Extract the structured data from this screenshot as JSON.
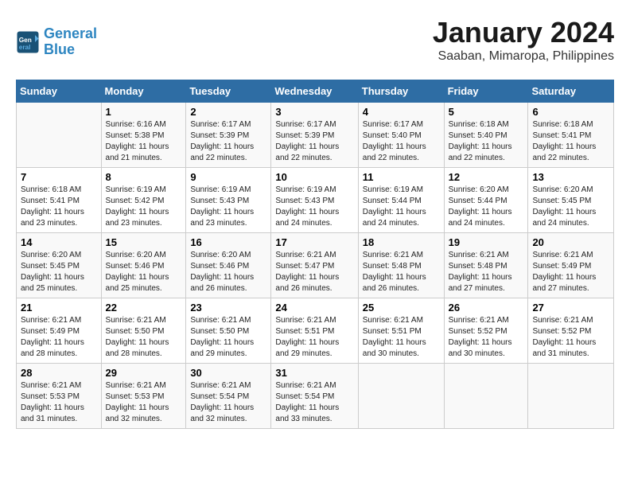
{
  "logo": {
    "line1": "General",
    "line2": "Blue"
  },
  "title": "January 2024",
  "subtitle": "Saaban, Mimaropa, Philippines",
  "weekdays": [
    "Sunday",
    "Monday",
    "Tuesday",
    "Wednesday",
    "Thursday",
    "Friday",
    "Saturday"
  ],
  "weeks": [
    [
      {
        "day": "",
        "sunrise": "",
        "sunset": "",
        "daylight": ""
      },
      {
        "day": "1",
        "sunrise": "Sunrise: 6:16 AM",
        "sunset": "Sunset: 5:38 PM",
        "daylight": "Daylight: 11 hours and 21 minutes."
      },
      {
        "day": "2",
        "sunrise": "Sunrise: 6:17 AM",
        "sunset": "Sunset: 5:39 PM",
        "daylight": "Daylight: 11 hours and 22 minutes."
      },
      {
        "day": "3",
        "sunrise": "Sunrise: 6:17 AM",
        "sunset": "Sunset: 5:39 PM",
        "daylight": "Daylight: 11 hours and 22 minutes."
      },
      {
        "day": "4",
        "sunrise": "Sunrise: 6:17 AM",
        "sunset": "Sunset: 5:40 PM",
        "daylight": "Daylight: 11 hours and 22 minutes."
      },
      {
        "day": "5",
        "sunrise": "Sunrise: 6:18 AM",
        "sunset": "Sunset: 5:40 PM",
        "daylight": "Daylight: 11 hours and 22 minutes."
      },
      {
        "day": "6",
        "sunrise": "Sunrise: 6:18 AM",
        "sunset": "Sunset: 5:41 PM",
        "daylight": "Daylight: 11 hours and 22 minutes."
      }
    ],
    [
      {
        "day": "7",
        "sunrise": "Sunrise: 6:18 AM",
        "sunset": "Sunset: 5:41 PM",
        "daylight": "Daylight: 11 hours and 23 minutes."
      },
      {
        "day": "8",
        "sunrise": "Sunrise: 6:19 AM",
        "sunset": "Sunset: 5:42 PM",
        "daylight": "Daylight: 11 hours and 23 minutes."
      },
      {
        "day": "9",
        "sunrise": "Sunrise: 6:19 AM",
        "sunset": "Sunset: 5:43 PM",
        "daylight": "Daylight: 11 hours and 23 minutes."
      },
      {
        "day": "10",
        "sunrise": "Sunrise: 6:19 AM",
        "sunset": "Sunset: 5:43 PM",
        "daylight": "Daylight: 11 hours and 24 minutes."
      },
      {
        "day": "11",
        "sunrise": "Sunrise: 6:19 AM",
        "sunset": "Sunset: 5:44 PM",
        "daylight": "Daylight: 11 hours and 24 minutes."
      },
      {
        "day": "12",
        "sunrise": "Sunrise: 6:20 AM",
        "sunset": "Sunset: 5:44 PM",
        "daylight": "Daylight: 11 hours and 24 minutes."
      },
      {
        "day": "13",
        "sunrise": "Sunrise: 6:20 AM",
        "sunset": "Sunset: 5:45 PM",
        "daylight": "Daylight: 11 hours and 24 minutes."
      }
    ],
    [
      {
        "day": "14",
        "sunrise": "Sunrise: 6:20 AM",
        "sunset": "Sunset: 5:45 PM",
        "daylight": "Daylight: 11 hours and 25 minutes."
      },
      {
        "day": "15",
        "sunrise": "Sunrise: 6:20 AM",
        "sunset": "Sunset: 5:46 PM",
        "daylight": "Daylight: 11 hours and 25 minutes."
      },
      {
        "day": "16",
        "sunrise": "Sunrise: 6:20 AM",
        "sunset": "Sunset: 5:46 PM",
        "daylight": "Daylight: 11 hours and 26 minutes."
      },
      {
        "day": "17",
        "sunrise": "Sunrise: 6:21 AM",
        "sunset": "Sunset: 5:47 PM",
        "daylight": "Daylight: 11 hours and 26 minutes."
      },
      {
        "day": "18",
        "sunrise": "Sunrise: 6:21 AM",
        "sunset": "Sunset: 5:48 PM",
        "daylight": "Daylight: 11 hours and 26 minutes."
      },
      {
        "day": "19",
        "sunrise": "Sunrise: 6:21 AM",
        "sunset": "Sunset: 5:48 PM",
        "daylight": "Daylight: 11 hours and 27 minutes."
      },
      {
        "day": "20",
        "sunrise": "Sunrise: 6:21 AM",
        "sunset": "Sunset: 5:49 PM",
        "daylight": "Daylight: 11 hours and 27 minutes."
      }
    ],
    [
      {
        "day": "21",
        "sunrise": "Sunrise: 6:21 AM",
        "sunset": "Sunset: 5:49 PM",
        "daylight": "Daylight: 11 hours and 28 minutes."
      },
      {
        "day": "22",
        "sunrise": "Sunrise: 6:21 AM",
        "sunset": "Sunset: 5:50 PM",
        "daylight": "Daylight: 11 hours and 28 minutes."
      },
      {
        "day": "23",
        "sunrise": "Sunrise: 6:21 AM",
        "sunset": "Sunset: 5:50 PM",
        "daylight": "Daylight: 11 hours and 29 minutes."
      },
      {
        "day": "24",
        "sunrise": "Sunrise: 6:21 AM",
        "sunset": "Sunset: 5:51 PM",
        "daylight": "Daylight: 11 hours and 29 minutes."
      },
      {
        "day": "25",
        "sunrise": "Sunrise: 6:21 AM",
        "sunset": "Sunset: 5:51 PM",
        "daylight": "Daylight: 11 hours and 30 minutes."
      },
      {
        "day": "26",
        "sunrise": "Sunrise: 6:21 AM",
        "sunset": "Sunset: 5:52 PM",
        "daylight": "Daylight: 11 hours and 30 minutes."
      },
      {
        "day": "27",
        "sunrise": "Sunrise: 6:21 AM",
        "sunset": "Sunset: 5:52 PM",
        "daylight": "Daylight: 11 hours and 31 minutes."
      }
    ],
    [
      {
        "day": "28",
        "sunrise": "Sunrise: 6:21 AM",
        "sunset": "Sunset: 5:53 PM",
        "daylight": "Daylight: 11 hours and 31 minutes."
      },
      {
        "day": "29",
        "sunrise": "Sunrise: 6:21 AM",
        "sunset": "Sunset: 5:53 PM",
        "daylight": "Daylight: 11 hours and 32 minutes."
      },
      {
        "day": "30",
        "sunrise": "Sunrise: 6:21 AM",
        "sunset": "Sunset: 5:54 PM",
        "daylight": "Daylight: 11 hours and 32 minutes."
      },
      {
        "day": "31",
        "sunrise": "Sunrise: 6:21 AM",
        "sunset": "Sunset: 5:54 PM",
        "daylight": "Daylight: 11 hours and 33 minutes."
      },
      {
        "day": "",
        "sunrise": "",
        "sunset": "",
        "daylight": ""
      },
      {
        "day": "",
        "sunrise": "",
        "sunset": "",
        "daylight": ""
      },
      {
        "day": "",
        "sunrise": "",
        "sunset": "",
        "daylight": ""
      }
    ]
  ]
}
